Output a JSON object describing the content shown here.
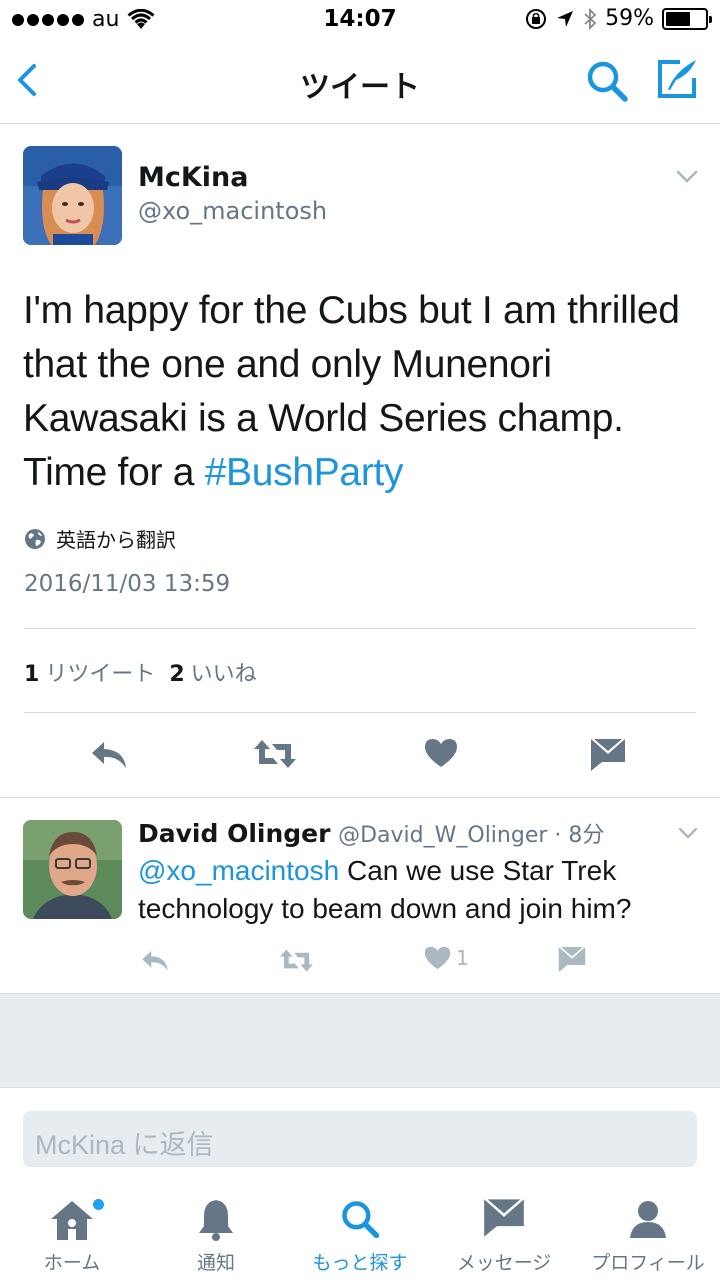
{
  "status_bar": {
    "carrier": "au",
    "time": "14:07",
    "battery": "59%"
  },
  "nav": {
    "title": "ツイート"
  },
  "tweet": {
    "name": "McKina",
    "handle": "@xo_macintosh",
    "text": "I'm happy for the Cubs but I am thrilled that the one and only Munenori Kawasaki is a World Series champ. Time for a ",
    "hashtag": "#BushParty",
    "translate_label": "英語から翻訳",
    "timestamp": "2016/11/03 13:59",
    "retweet_count": "1",
    "retweet_label": "リツイート",
    "like_count": "2",
    "like_label": "いいね"
  },
  "reply": {
    "name": "David Olinger",
    "meta": "@David_W_Olinger · 8分",
    "mention": "@xo_macintosh",
    "text": " Can we use Star Trek technology to beam down and join him?",
    "like_count": "1"
  },
  "reply_box": {
    "placeholder": "McKina に返信"
  },
  "tabs": [
    {
      "label": "ホーム",
      "icon": "home-icon"
    },
    {
      "label": "通知",
      "icon": "bell-icon"
    },
    {
      "label": "もっと探す",
      "icon": "search-icon"
    },
    {
      "label": "メッセージ",
      "icon": "envelope-icon"
    },
    {
      "label": "プロフィール",
      "icon": "person-icon"
    }
  ],
  "colors": {
    "accent": "#1b95e0",
    "muted": "#657786",
    "icon": "#657786",
    "light_icon": "#aab8c2"
  }
}
